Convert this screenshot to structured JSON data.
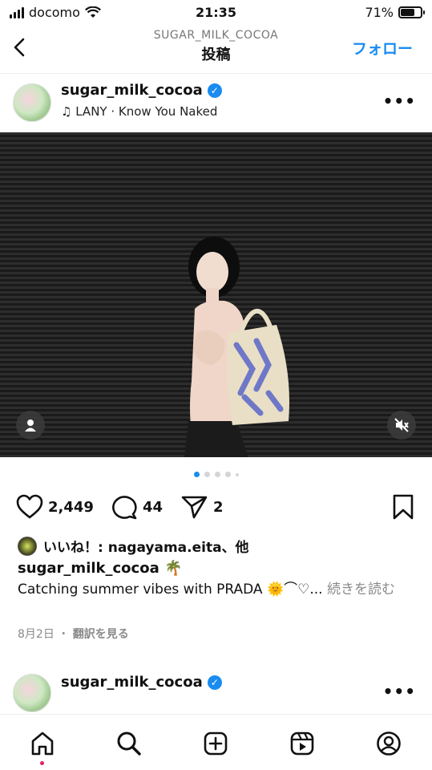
{
  "status_bar": {
    "carrier": "docomo",
    "time": "21:35",
    "battery": "71%",
    "battery_level": 0.71
  },
  "header": {
    "subtitle": "SUGAR_MILK_COCOA",
    "title": "投稿",
    "follow_label": "フォロー"
  },
  "post": {
    "username": "sugar_milk_cocoa",
    "verified_mark": "✓",
    "music": "LANY · Know You Naked",
    "more_label": "•••",
    "carousel": {
      "count": 5,
      "active_index": 0
    },
    "likes_count": "2,449",
    "comments_count": "44",
    "shares_count": "2",
    "liked_by": "いいね！: nagayama.eita、他",
    "caption_username": "sugar_milk_cocoa 🌴",
    "caption_text": "Catching summer vibes with PRADA 🌞⌒♡...",
    "caption_more": "続きを読む",
    "date": "8月2日",
    "separator": "・",
    "translate": "翻訳を見る"
  },
  "next_post": {
    "username": "sugar_milk_cocoa",
    "verified_mark": "✓",
    "more_label": "•••"
  },
  "colors": {
    "accent": "#1a8cf0",
    "notification": "#e0245e"
  },
  "bottom_nav": [
    "home-icon",
    "search-icon",
    "create-icon",
    "reels-icon",
    "profile-icon"
  ]
}
